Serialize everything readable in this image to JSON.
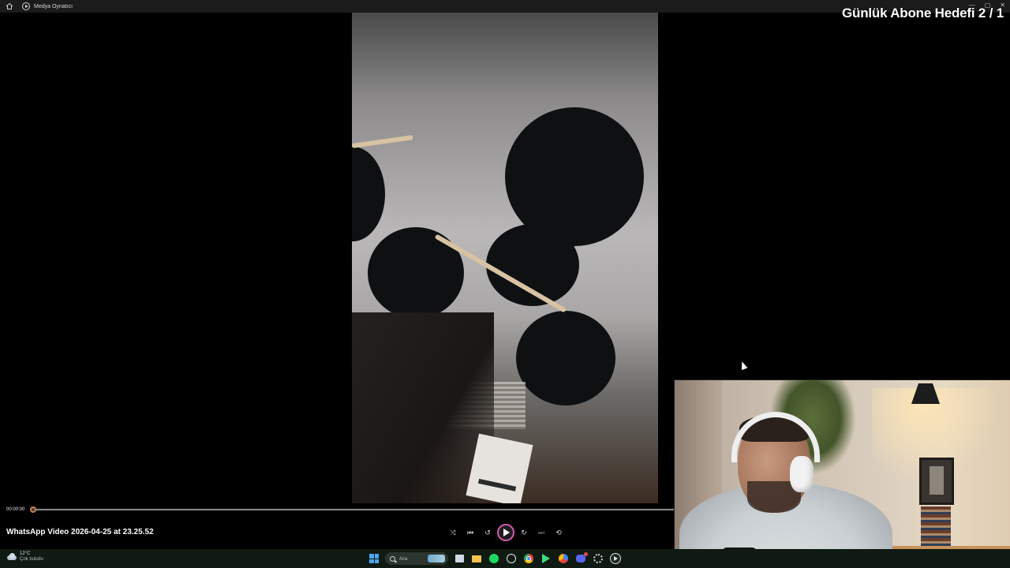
{
  "window": {
    "title": "Medya Oynatıcı",
    "controls": [
      "—",
      "▢",
      "✕"
    ]
  },
  "overlay": {
    "goal_text": "Günlük Abone Hedefi 2 / 1"
  },
  "player": {
    "current_time": "00:00:00",
    "progress_fraction": 0.0,
    "video_title": "WhatsApp Video 2026-04-25 at 23.25.52",
    "accent_color": "#c98350",
    "controls": {
      "shuffle_icon": "⤨",
      "prev_icon": "⏮",
      "rewind_icon": "↺",
      "forward_icon": "↻",
      "next_icon": "⏭",
      "repeat_icon": "⟲"
    }
  },
  "taskbar": {
    "weather_temp": "12°C",
    "weather_desc": "Çok bulutlu",
    "search_placeholder": "Ara"
  }
}
